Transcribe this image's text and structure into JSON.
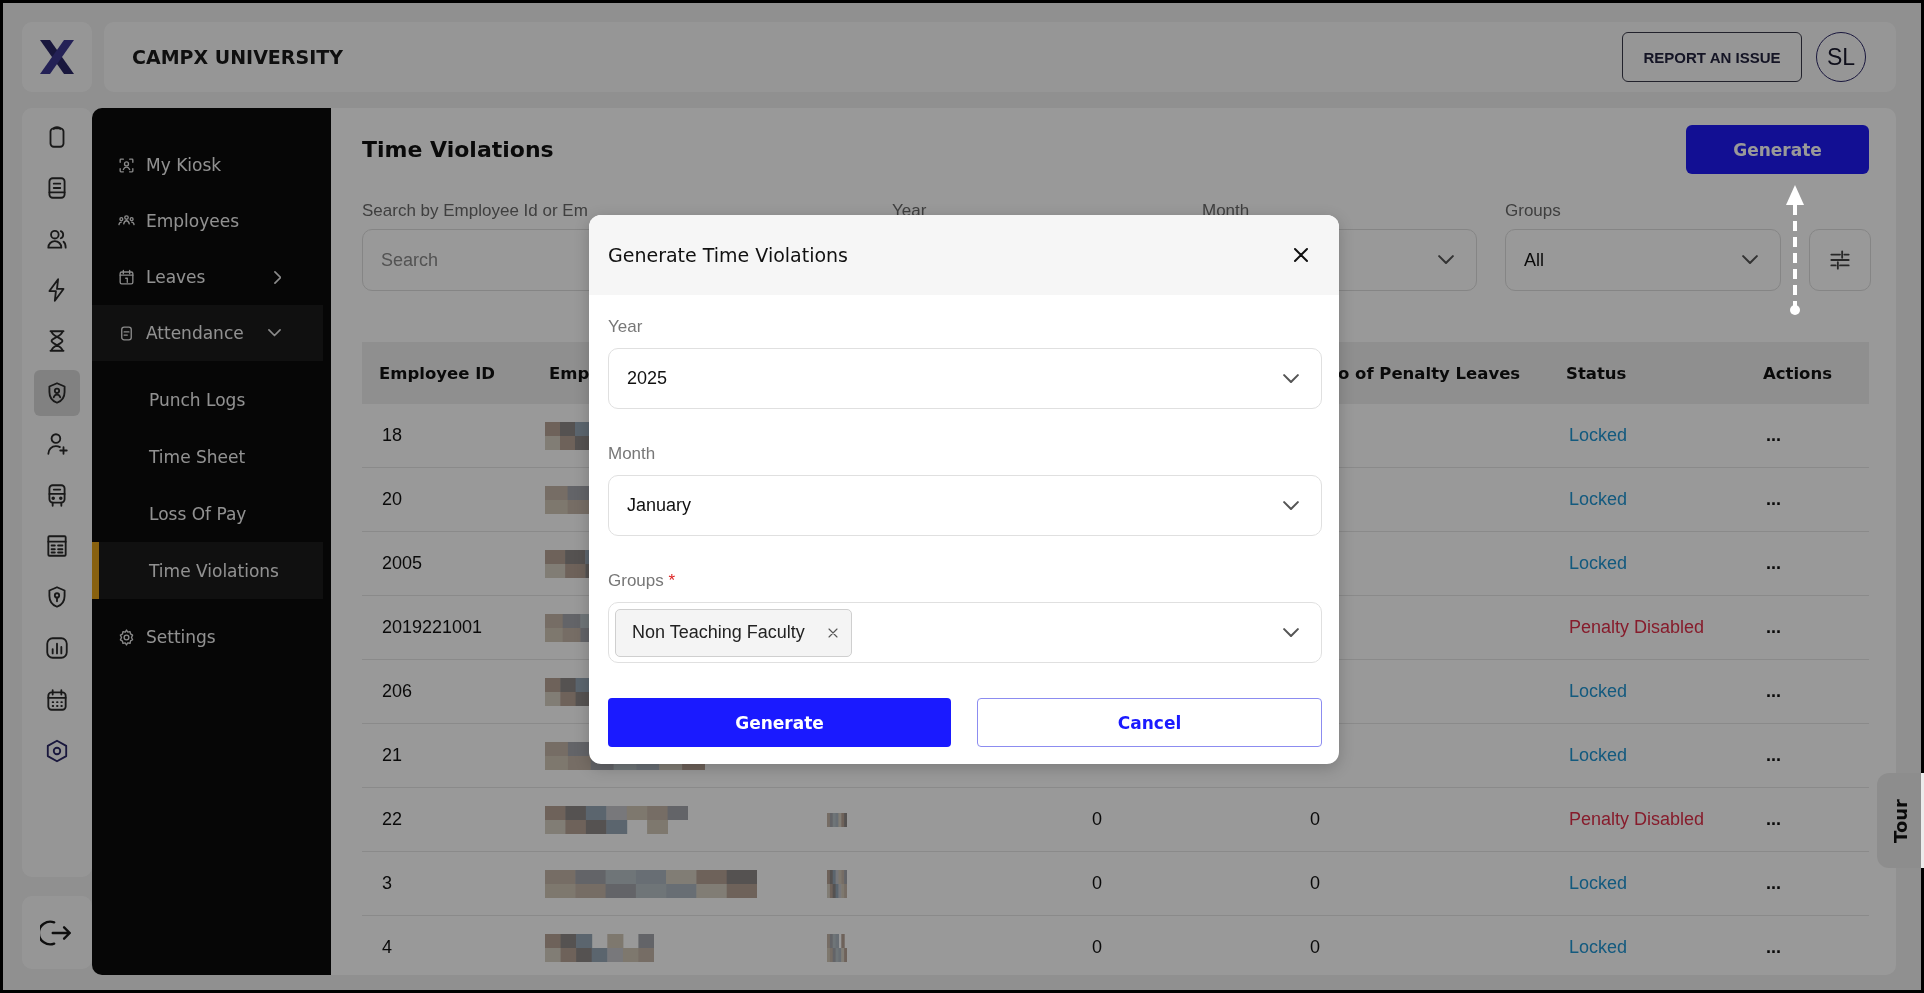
{
  "header": {
    "title": "CAMPX UNIVERSITY",
    "report_button": "REPORT AN ISSUE",
    "avatar": "SL"
  },
  "rail": {
    "items": [
      {
        "selected": false
      },
      {
        "selected": false
      },
      {
        "selected": false
      },
      {
        "selected": false
      },
      {
        "selected": false
      },
      {
        "selected": true
      },
      {
        "selected": false
      },
      {
        "selected": false
      },
      {
        "selected": false
      },
      {
        "selected": false
      },
      {
        "selected": false
      },
      {
        "selected": false
      },
      {
        "selected": false
      }
    ]
  },
  "sidebar": {
    "items": [
      {
        "label": "My Kiosk",
        "selected": false
      },
      {
        "label": "Employees",
        "selected": false
      },
      {
        "label": "Leaves",
        "selected": false,
        "expanded": false
      },
      {
        "label": "Attendance",
        "selected": false,
        "expanded": true,
        "children": [
          {
            "label": "Punch Logs",
            "selected": false
          },
          {
            "label": "Time Sheet",
            "selected": false
          },
          {
            "label": "Loss Of Pay",
            "selected": false
          },
          {
            "label": "Time Violations",
            "selected": true
          }
        ]
      },
      {
        "label": "Settings",
        "selected": false
      }
    ]
  },
  "page": {
    "title": "Time Violations",
    "generate_button": "Generate",
    "filters": [
      {
        "kind": "search",
        "label": "Search by Employee Id or Em",
        "placeholder": "Search"
      },
      {
        "kind": "hidden",
        "label": "Year"
      },
      {
        "kind": "select",
        "label": "Month"
      },
      {
        "kind": "select",
        "label": "Groups",
        "value": "All"
      }
    ],
    "table": {
      "columns": [
        {
          "label": "Employee ID"
        },
        {
          "label": "Emp"
        },
        {},
        {},
        {
          "label": "o of Penalty Leaves"
        },
        {
          "label": "Status"
        },
        {
          "label": "Actions"
        }
      ],
      "rows": [
        {
          "employee_id": "18",
          "status": {
            "text": "Locked",
            "kind": "locked"
          },
          "actions": "..."
        },
        {
          "employee_id": "20",
          "status": {
            "text": "Locked",
            "kind": "locked"
          },
          "actions": "..."
        },
        {
          "employee_id": "2005",
          "status": {
            "text": "Locked",
            "kind": "locked"
          },
          "actions": "..."
        },
        {
          "employee_id": "2019221001",
          "status": {
            "text": "Penalty Disabled",
            "kind": "disabled"
          },
          "actions": "..."
        },
        {
          "employee_id": "206",
          "status": {
            "text": "Locked",
            "kind": "locked"
          },
          "actions": "..."
        },
        {
          "employee_id": "21",
          "status": {
            "text": "Locked",
            "kind": "locked"
          },
          "actions": "..."
        },
        {
          "employee_id": "22",
          "column_4": "0",
          "penalty_leaves": "0",
          "status": {
            "text": "Penalty Disabled",
            "kind": "disabled"
          },
          "actions": "..."
        },
        {
          "employee_id": "3",
          "column_4": "0",
          "penalty_leaves": "0",
          "status": {
            "text": "Locked",
            "kind": "locked"
          },
          "actions": "..."
        },
        {
          "employee_id": "4",
          "column_4": "0",
          "penalty_leaves": "0",
          "status": {
            "text": "Locked",
            "kind": "locked"
          },
          "actions": "..."
        }
      ]
    }
  },
  "dialog": {
    "title": "Generate Time Violations",
    "fields": [
      {
        "label": "Year",
        "value": "2025"
      },
      {
        "label": "Month",
        "value": "January"
      },
      {
        "label": "Groups",
        "required_mark": "*",
        "chips": [
          "Non Teaching Faculty"
        ]
      }
    ],
    "buttons": [
      {
        "label": "Generate",
        "kind": "primary"
      },
      {
        "label": "Cancel",
        "kind": "secondary"
      }
    ]
  },
  "tour": "Tour"
}
